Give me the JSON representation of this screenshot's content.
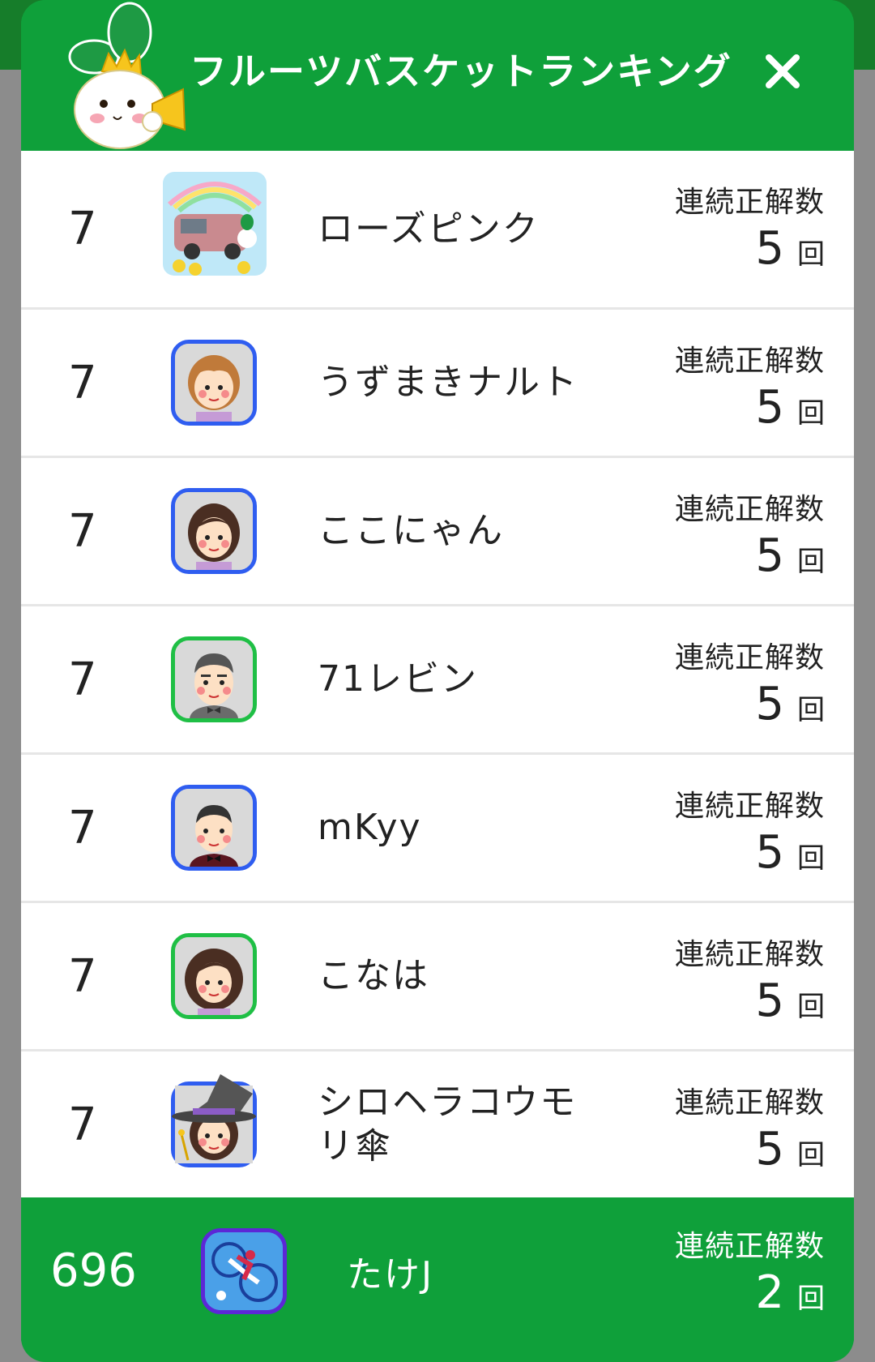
{
  "dialog": {
    "title": "フルーツバスケットランキング",
    "close_icon": "close-icon",
    "mascot_icon": "rabbit-mascot-megaphone-icon"
  },
  "score_label": "連続正解数",
  "score_unit": "回",
  "rows": [
    {
      "rank": "7",
      "name": "ローズピンク",
      "score": "5",
      "avatar": "car-photo-avatar"
    },
    {
      "rank": "7",
      "name": "うずまきナルト",
      "score": "5",
      "avatar": "woman-short-hair-avatar"
    },
    {
      "rank": "7",
      "name": "ここにゃん",
      "score": "5",
      "avatar": "woman-bob-hair-avatar"
    },
    {
      "rank": "7",
      "name": "71レビン",
      "score": "5",
      "avatar": "man-bowtie-avatar"
    },
    {
      "rank": "7",
      "name": "mKyy",
      "score": "5",
      "avatar": "older-man-avatar"
    },
    {
      "rank": "7",
      "name": "こなは",
      "score": "5",
      "avatar": "woman-wavy-hair-avatar"
    },
    {
      "rank": "7",
      "name": "シロヘラコウモリ傘",
      "score": "5",
      "avatar": "witch-avatar"
    }
  ],
  "me": {
    "rank": "696",
    "name": "たけJ",
    "score": "2",
    "avatar": "bike-photo-avatar"
  }
}
